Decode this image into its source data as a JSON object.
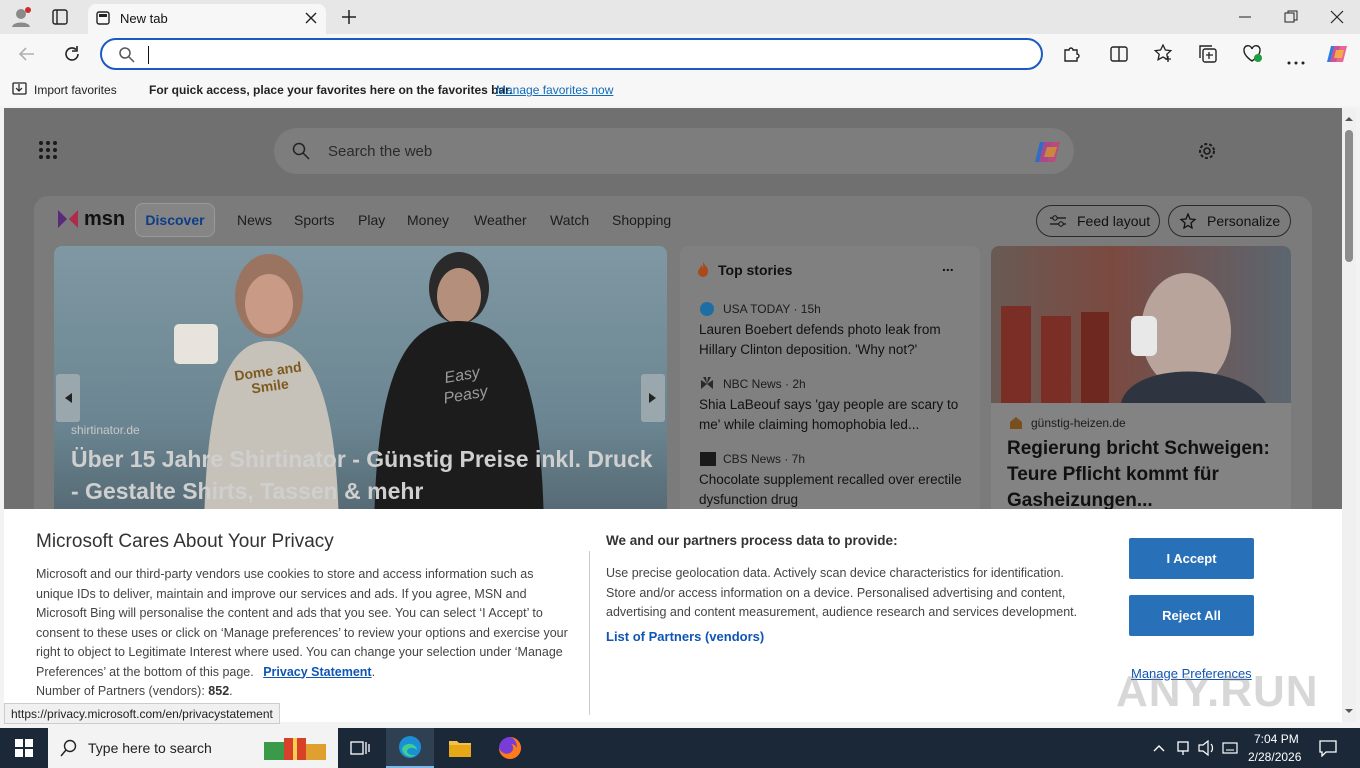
{
  "browser": {
    "tab_title": "New tab",
    "address_value": "",
    "favorites_bar": {
      "import_label": "Import favorites",
      "message": "For quick access, place your favorites here on the favorites bar.",
      "manage_link": "Manage favorites now"
    }
  },
  "newtab": {
    "search_placeholder": "Search the web",
    "msn_logo": "msn",
    "nav": [
      "Discover",
      "News",
      "Sports",
      "Play",
      "Money",
      "Weather",
      "Watch",
      "Shopping"
    ],
    "feed_layout": "Feed layout",
    "personalize": "Personalize",
    "hero": {
      "source": "shirtinator.de",
      "title": "Über 15 Jahre Shirtinator - Günstig Preise inkl. Druck - Gestalte Shirts, Tassen & mehr",
      "mug_text": "Dome and Smile",
      "hoodie_text": "Easy Peasy"
    },
    "top_stories": {
      "title": "Top stories",
      "more": "...",
      "items": [
        {
          "source": "USA TODAY · 15h",
          "title": "Lauren Boebert defends photo leak from Hillary Clinton deposition. 'Why not?'"
        },
        {
          "source": "NBC News · 2h",
          "title": "Shia LaBeouf says 'gay people are scary to me' while claiming homophobia led..."
        },
        {
          "source": "CBS News · 7h",
          "title": "Chocolate supplement recalled over erectile dysfunction drug"
        }
      ]
    },
    "right_card": {
      "source": "günstig-heizen.de",
      "title": "Regierung bricht Schweigen: Teure Pflicht kommt für Gasheizungen..."
    }
  },
  "privacy": {
    "heading": "Microsoft Cares About Your Privacy",
    "body": "Microsoft and our third-party vendors use cookies to store and access information such as unique IDs to deliver, maintain and improve our services and ads. If you agree, MSN and Microsoft Bing will personalise the content and ads that you see. You can select ‘I Accept’ to consent to these uses or click on ‘Manage preferences’ to review your options and exercise your right to object to Legitimate Interest where used.  You can change your selection under ‘Manage Preferences’ at the bottom of this page.",
    "statement_link": "Privacy Statement",
    "partners_label": "Number of Partners (vendors):",
    "partners_count": "852",
    "data_heading": "We and our partners process data to provide:",
    "data_body": "Use precise geolocation data. Actively scan device characteristics for identification. Store and/or access information on a device. Personalised advertising and content, advertising and content measurement, audience research and services development.",
    "partners_link": "List of Partners (vendors)",
    "accept": "I Accept",
    "reject": "Reject All",
    "manage": "Manage Preferences"
  },
  "status_url": "https://privacy.microsoft.com/en/privacystatement",
  "watermark": "ANY.RUN",
  "taskbar": {
    "search_placeholder": "Type here to search",
    "time": "7:04 PM",
    "date": "2/28/2026"
  }
}
